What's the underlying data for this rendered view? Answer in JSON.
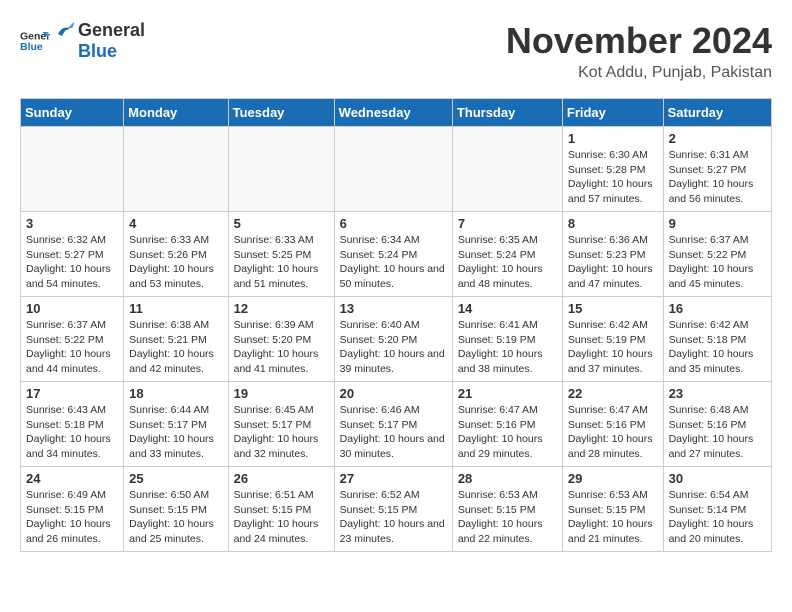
{
  "header": {
    "logo_general": "General",
    "logo_blue": "Blue",
    "month": "November 2024",
    "location": "Kot Addu, Punjab, Pakistan"
  },
  "days_of_week": [
    "Sunday",
    "Monday",
    "Tuesday",
    "Wednesday",
    "Thursday",
    "Friday",
    "Saturday"
  ],
  "weeks": [
    [
      {
        "day": "",
        "empty": true
      },
      {
        "day": "",
        "empty": true
      },
      {
        "day": "",
        "empty": true
      },
      {
        "day": "",
        "empty": true
      },
      {
        "day": "",
        "empty": true
      },
      {
        "day": "1",
        "sunrise": "Sunrise: 6:30 AM",
        "sunset": "Sunset: 5:28 PM",
        "daylight": "Daylight: 10 hours and 57 minutes."
      },
      {
        "day": "2",
        "sunrise": "Sunrise: 6:31 AM",
        "sunset": "Sunset: 5:27 PM",
        "daylight": "Daylight: 10 hours and 56 minutes."
      }
    ],
    [
      {
        "day": "3",
        "sunrise": "Sunrise: 6:32 AM",
        "sunset": "Sunset: 5:27 PM",
        "daylight": "Daylight: 10 hours and 54 minutes."
      },
      {
        "day": "4",
        "sunrise": "Sunrise: 6:33 AM",
        "sunset": "Sunset: 5:26 PM",
        "daylight": "Daylight: 10 hours and 53 minutes."
      },
      {
        "day": "5",
        "sunrise": "Sunrise: 6:33 AM",
        "sunset": "Sunset: 5:25 PM",
        "daylight": "Daylight: 10 hours and 51 minutes."
      },
      {
        "day": "6",
        "sunrise": "Sunrise: 6:34 AM",
        "sunset": "Sunset: 5:24 PM",
        "daylight": "Daylight: 10 hours and 50 minutes."
      },
      {
        "day": "7",
        "sunrise": "Sunrise: 6:35 AM",
        "sunset": "Sunset: 5:24 PM",
        "daylight": "Daylight: 10 hours and 48 minutes."
      },
      {
        "day": "8",
        "sunrise": "Sunrise: 6:36 AM",
        "sunset": "Sunset: 5:23 PM",
        "daylight": "Daylight: 10 hours and 47 minutes."
      },
      {
        "day": "9",
        "sunrise": "Sunrise: 6:37 AM",
        "sunset": "Sunset: 5:22 PM",
        "daylight": "Daylight: 10 hours and 45 minutes."
      }
    ],
    [
      {
        "day": "10",
        "sunrise": "Sunrise: 6:37 AM",
        "sunset": "Sunset: 5:22 PM",
        "daylight": "Daylight: 10 hours and 44 minutes."
      },
      {
        "day": "11",
        "sunrise": "Sunrise: 6:38 AM",
        "sunset": "Sunset: 5:21 PM",
        "daylight": "Daylight: 10 hours and 42 minutes."
      },
      {
        "day": "12",
        "sunrise": "Sunrise: 6:39 AM",
        "sunset": "Sunset: 5:20 PM",
        "daylight": "Daylight: 10 hours and 41 minutes."
      },
      {
        "day": "13",
        "sunrise": "Sunrise: 6:40 AM",
        "sunset": "Sunset: 5:20 PM",
        "daylight": "Daylight: 10 hours and 39 minutes."
      },
      {
        "day": "14",
        "sunrise": "Sunrise: 6:41 AM",
        "sunset": "Sunset: 5:19 PM",
        "daylight": "Daylight: 10 hours and 38 minutes."
      },
      {
        "day": "15",
        "sunrise": "Sunrise: 6:42 AM",
        "sunset": "Sunset: 5:19 PM",
        "daylight": "Daylight: 10 hours and 37 minutes."
      },
      {
        "day": "16",
        "sunrise": "Sunrise: 6:42 AM",
        "sunset": "Sunset: 5:18 PM",
        "daylight": "Daylight: 10 hours and 35 minutes."
      }
    ],
    [
      {
        "day": "17",
        "sunrise": "Sunrise: 6:43 AM",
        "sunset": "Sunset: 5:18 PM",
        "daylight": "Daylight: 10 hours and 34 minutes."
      },
      {
        "day": "18",
        "sunrise": "Sunrise: 6:44 AM",
        "sunset": "Sunset: 5:17 PM",
        "daylight": "Daylight: 10 hours and 33 minutes."
      },
      {
        "day": "19",
        "sunrise": "Sunrise: 6:45 AM",
        "sunset": "Sunset: 5:17 PM",
        "daylight": "Daylight: 10 hours and 32 minutes."
      },
      {
        "day": "20",
        "sunrise": "Sunrise: 6:46 AM",
        "sunset": "Sunset: 5:17 PM",
        "daylight": "Daylight: 10 hours and 30 minutes."
      },
      {
        "day": "21",
        "sunrise": "Sunrise: 6:47 AM",
        "sunset": "Sunset: 5:16 PM",
        "daylight": "Daylight: 10 hours and 29 minutes."
      },
      {
        "day": "22",
        "sunrise": "Sunrise: 6:47 AM",
        "sunset": "Sunset: 5:16 PM",
        "daylight": "Daylight: 10 hours and 28 minutes."
      },
      {
        "day": "23",
        "sunrise": "Sunrise: 6:48 AM",
        "sunset": "Sunset: 5:16 PM",
        "daylight": "Daylight: 10 hours and 27 minutes."
      }
    ],
    [
      {
        "day": "24",
        "sunrise": "Sunrise: 6:49 AM",
        "sunset": "Sunset: 5:15 PM",
        "daylight": "Daylight: 10 hours and 26 minutes."
      },
      {
        "day": "25",
        "sunrise": "Sunrise: 6:50 AM",
        "sunset": "Sunset: 5:15 PM",
        "daylight": "Daylight: 10 hours and 25 minutes."
      },
      {
        "day": "26",
        "sunrise": "Sunrise: 6:51 AM",
        "sunset": "Sunset: 5:15 PM",
        "daylight": "Daylight: 10 hours and 24 minutes."
      },
      {
        "day": "27",
        "sunrise": "Sunrise: 6:52 AM",
        "sunset": "Sunset: 5:15 PM",
        "daylight": "Daylight: 10 hours and 23 minutes."
      },
      {
        "day": "28",
        "sunrise": "Sunrise: 6:53 AM",
        "sunset": "Sunset: 5:15 PM",
        "daylight": "Daylight: 10 hours and 22 minutes."
      },
      {
        "day": "29",
        "sunrise": "Sunrise: 6:53 AM",
        "sunset": "Sunset: 5:15 PM",
        "daylight": "Daylight: 10 hours and 21 minutes."
      },
      {
        "day": "30",
        "sunrise": "Sunrise: 6:54 AM",
        "sunset": "Sunset: 5:14 PM",
        "daylight": "Daylight: 10 hours and 20 minutes."
      }
    ]
  ]
}
